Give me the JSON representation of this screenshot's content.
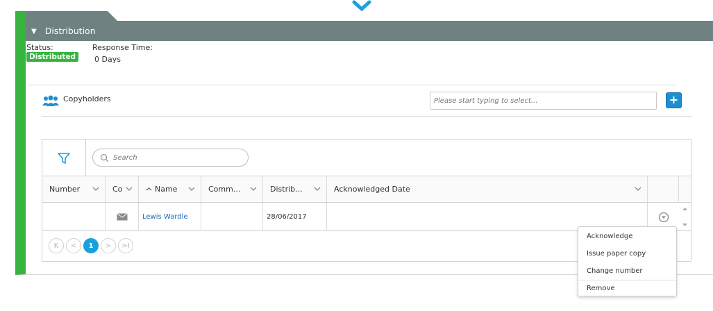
{
  "panel": {
    "title": "Distribution"
  },
  "status": {
    "label": "Status:",
    "value": "Distributed"
  },
  "response": {
    "label": "Response Time:",
    "value": "0 Days"
  },
  "copyholders": {
    "label": "Copyholders",
    "placeholder": "Please start typing to select...",
    "add_label": "+"
  },
  "grid": {
    "search_placeholder": "Search",
    "columns": [
      "Number",
      "Co",
      "Name",
      "Comm...",
      "Distrib...",
      "Acknowledged Date"
    ],
    "rows": [
      {
        "number": "",
        "name": "Lewis Wardle",
        "comments": "",
        "distributed": "28/06/2017",
        "acknowledged": ""
      }
    ],
    "pager": {
      "first": "K",
      "prev": "<",
      "current": "1",
      "next": ">",
      "last": ">I"
    }
  },
  "menu": {
    "items": [
      "Acknowledge",
      "Issue paper copy",
      "Change number",
      "Remove"
    ]
  },
  "colors": {
    "accent_green": "#36b43f",
    "header_gray": "#6f8281",
    "link_blue": "#1f67b8",
    "primary_blue": "#1aa0dc"
  }
}
